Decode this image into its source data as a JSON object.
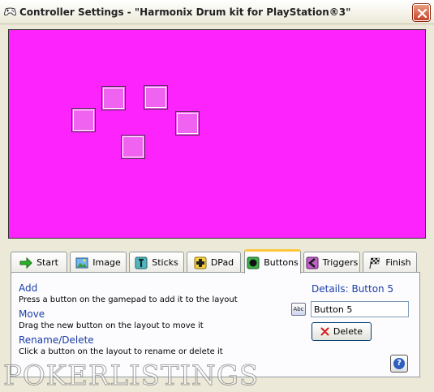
{
  "window": {
    "title": "Controller Settings - \"Harmonix Drum kit for PlayStation®3\"",
    "close_icon": "close-icon",
    "app_icon": "gamepad-icon"
  },
  "layout_canvas": {
    "background_color": "#fd23fd",
    "button_color": "#f062f0",
    "button_count": 5
  },
  "tabs": [
    {
      "label": "Start",
      "icon": "arrow-right-icon",
      "active": false
    },
    {
      "label": "Image",
      "icon": "image-icon",
      "active": false
    },
    {
      "label": "Sticks",
      "icon": "stick-icon",
      "active": false
    },
    {
      "label": "DPad",
      "icon": "dpad-icon",
      "active": false
    },
    {
      "label": "Buttons",
      "icon": "buttons-icon",
      "active": true
    },
    {
      "label": "Triggers",
      "icon": "trigger-icon",
      "active": false
    },
    {
      "label": "Finish",
      "icon": "checkered-flag-icon",
      "active": false
    }
  ],
  "instructions": {
    "add_title": "Add",
    "add_desc": "Press a button on the gamepad to add it to the layout",
    "move_title": "Move",
    "move_desc": "Drag the new button on the layout to move it",
    "rename_title": "Rename/Delete",
    "rename_desc": "Click a button on the layout to rename or delete it"
  },
  "details": {
    "label": "Details: Button 5",
    "name_value": "Button 5",
    "name_icon": "abc-label-icon",
    "name_icon_text": "Abc",
    "delete_label": "Delete"
  },
  "help": {
    "glyph": "?"
  },
  "watermark": "POKERLISTINGS"
}
